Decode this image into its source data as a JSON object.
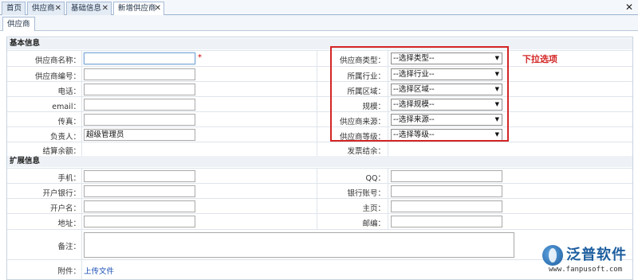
{
  "tabs": [
    {
      "label": "首页",
      "closable": false
    },
    {
      "label": "供应商",
      "closable": true
    },
    {
      "label": "基础信息",
      "closable": true
    },
    {
      "label": "新增供应商",
      "closable": true,
      "active": true
    }
  ],
  "sub_tab": "供应商",
  "sections": {
    "basic": "基本信息",
    "extended": "扩展信息"
  },
  "basic_left": [
    {
      "label": "供应商名称：",
      "value": "",
      "required": true
    },
    {
      "label": "供应商编号：",
      "value": ""
    },
    {
      "label": "电话：",
      "value": ""
    },
    {
      "label": "email：",
      "value": ""
    },
    {
      "label": "传真：",
      "value": ""
    },
    {
      "label": "负责人：",
      "value": "超级管理员"
    },
    {
      "label": "结算余额：",
      "value": ""
    }
  ],
  "basic_right": [
    {
      "label": "供应商类型：",
      "select": "--选择类型--"
    },
    {
      "label": "所属行业：",
      "select": "--选择行业--"
    },
    {
      "label": "所属区域：",
      "select": "--选择区域--"
    },
    {
      "label": "规模：",
      "select": "--选择规模--"
    },
    {
      "label": "供应商来源：",
      "select": "--选择来源--"
    },
    {
      "label": "供应商等级：",
      "select": "--选择等级--"
    },
    {
      "label": "发票结余：",
      "select": ""
    }
  ],
  "ext_left": [
    {
      "label": "手机："
    },
    {
      "label": "开户银行："
    },
    {
      "label": "开户名："
    },
    {
      "label": "地址："
    }
  ],
  "ext_right": [
    {
      "label": "QQ："
    },
    {
      "label": "银行账号："
    },
    {
      "label": "主页："
    },
    {
      "label": "邮编："
    }
  ],
  "remark_label": "备注：",
  "attachment_label": "附件：",
  "upload_link": "上传文件",
  "annotation": "下拉选项",
  "required_mark": "*",
  "logo": {
    "name": "泛普软件",
    "url": "www.fanpusoft.com"
  },
  "colors": {
    "annotation": "#d42525",
    "tab_border": "#a9bdd6",
    "link": "#1a4fb5"
  }
}
